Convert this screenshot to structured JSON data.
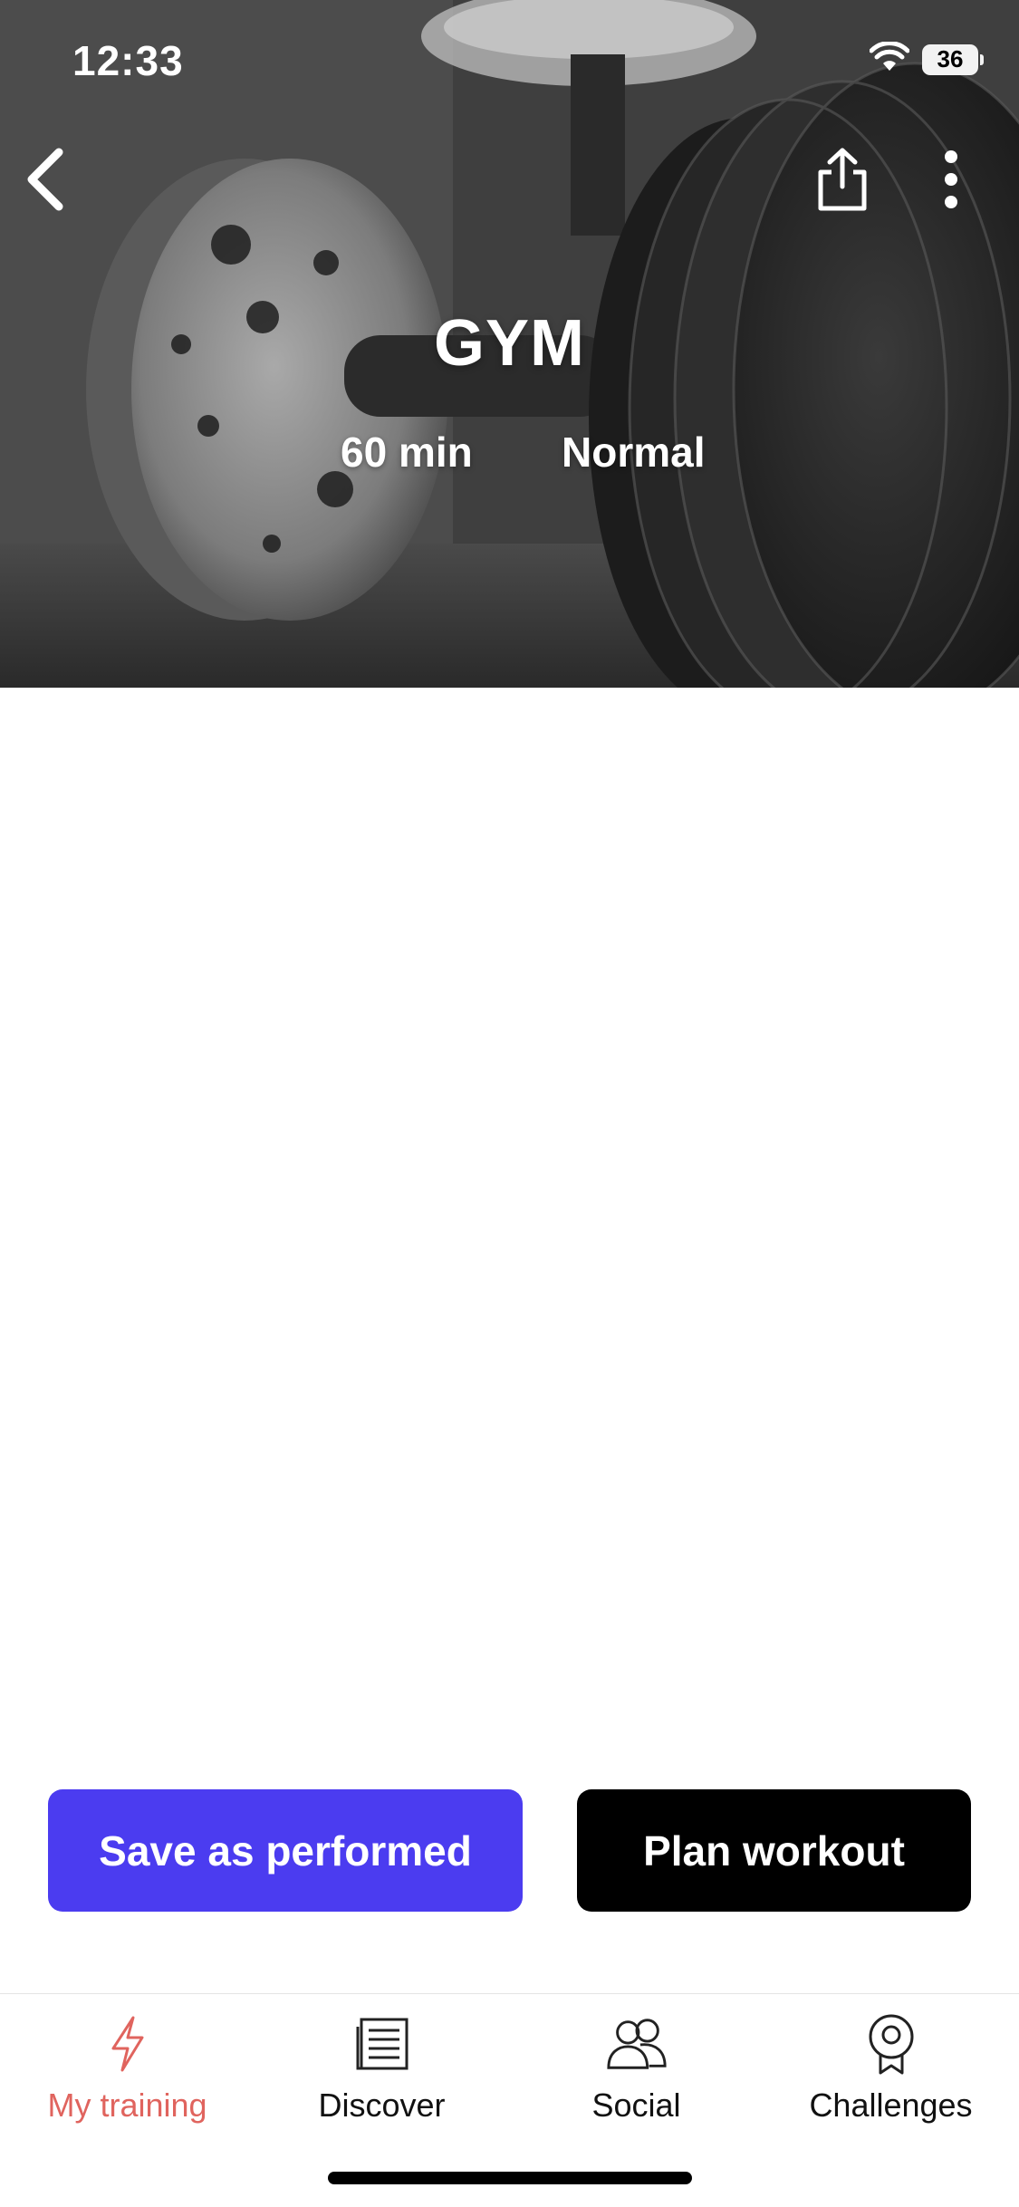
{
  "status_bar": {
    "time": "12:33",
    "battery": "36"
  },
  "header": {
    "back_icon": "chevron-left-icon",
    "share_icon": "share-icon",
    "more_icon": "more-vertical-icon"
  },
  "workout": {
    "title": "GYM",
    "duration": "60 min",
    "level": "Normal"
  },
  "actions": {
    "save_label": "Save as performed",
    "plan_label": "Plan workout"
  },
  "colors": {
    "primary_button": "#4b3cf0",
    "secondary_button": "#000000",
    "active_tab": "#e0645e"
  },
  "tabs": [
    {
      "label": "My training",
      "icon": "lightning-icon",
      "active": true
    },
    {
      "label": "Discover",
      "icon": "news-icon",
      "active": false
    },
    {
      "label": "Social",
      "icon": "people-icon",
      "active": false
    },
    {
      "label": "Challenges",
      "icon": "medal-icon",
      "active": false
    }
  ]
}
